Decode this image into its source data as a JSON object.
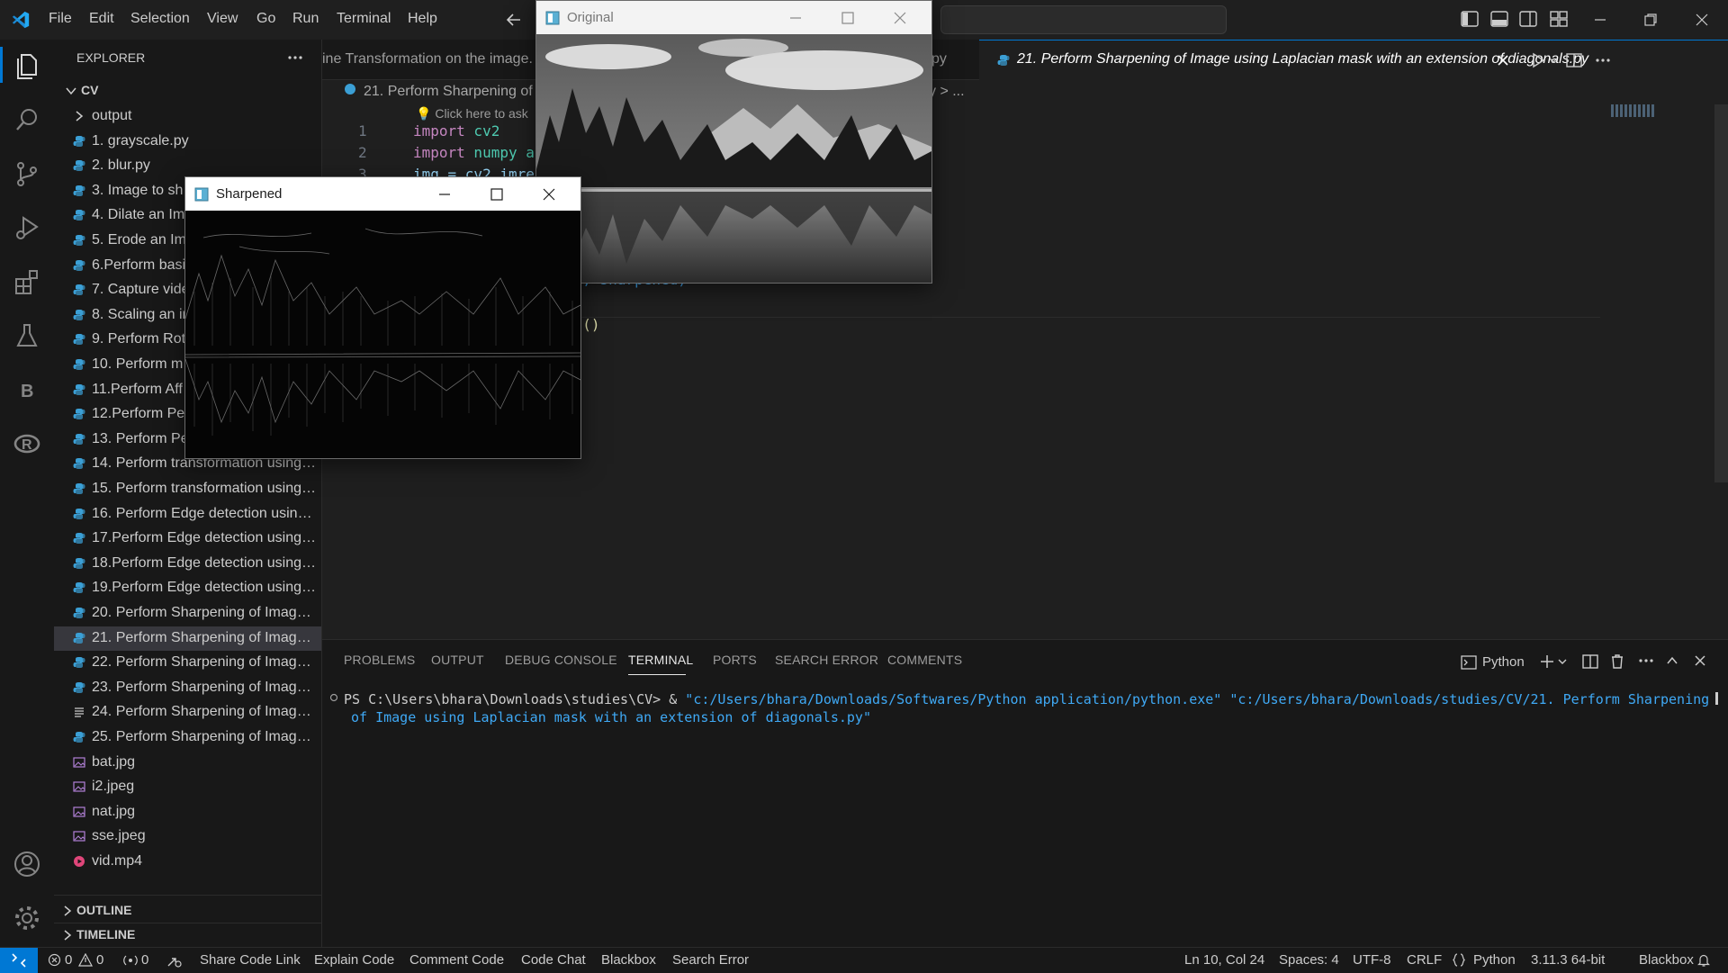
{
  "menu": [
    "File",
    "Edit",
    "Selection",
    "View",
    "Go",
    "Run",
    "Terminal",
    "Help"
  ],
  "explorer": {
    "title": "EXPLORER",
    "root": "CV",
    "items": [
      {
        "label": "output",
        "kind": "folder"
      },
      {
        "label": "1. grayscale.py",
        "kind": "py"
      },
      {
        "label": "2. blur.py",
        "kind": "py"
      },
      {
        "label": "3. Image to sh",
        "kind": "py"
      },
      {
        "label": "4. Dilate an Im",
        "kind": "py"
      },
      {
        "label": "5. Erode an Im",
        "kind": "py"
      },
      {
        "label": "6.Perform basi",
        "kind": "py"
      },
      {
        "label": "7. Capture vide",
        "kind": "py"
      },
      {
        "label": "8. Scaling an in",
        "kind": "py"
      },
      {
        "label": "9. Perform Rot",
        "kind": "py"
      },
      {
        "label": "10. Perform m",
        "kind": "py"
      },
      {
        "label": "11.Perform Aff",
        "kind": "py"
      },
      {
        "label": "12.Perform Pe",
        "kind": "py"
      },
      {
        "label": "13.  Perform Pe",
        "kind": "py"
      },
      {
        "label": "14. Perform transformation using ...",
        "kind": "py"
      },
      {
        "label": "15. Perform transformation using ...",
        "kind": "py"
      },
      {
        "label": "16. Perform Edge detection using...",
        "kind": "py"
      },
      {
        "label": "17.Perform Edge detection using ...",
        "kind": "py"
      },
      {
        "label": "18.Perform Edge detection using ...",
        "kind": "py"
      },
      {
        "label": "19.Perform Edge detection using ...",
        "kind": "py"
      },
      {
        "label": "20. Perform Sharpening of Image ...",
        "kind": "py"
      },
      {
        "label": "21. Perform Sharpening of Image ...",
        "kind": "py",
        "selected": true
      },
      {
        "label": "22. Perform Sharpening of Image ...",
        "kind": "py"
      },
      {
        "label": "23. Perform Sharpening of Image ...",
        "kind": "py"
      },
      {
        "label": "24. Perform Sharpening of Image ...",
        "kind": "txt"
      },
      {
        "label": "25. Perform Sharpening of Image ...",
        "kind": "py"
      },
      {
        "label": "bat.jpg",
        "kind": "img"
      },
      {
        "label": "i2.jpeg",
        "kind": "img"
      },
      {
        "label": "nat.jpg",
        "kind": "img"
      },
      {
        "label": "sse.jpeg",
        "kind": "img"
      },
      {
        "label": "vid.mp4",
        "kind": "video"
      }
    ],
    "outline": "OUTLINE",
    "timeline": "TIMELINE"
  },
  "editor": {
    "left_tab": "ine Transformation on the image.",
    "middle_tab_suffix": "py",
    "active_tab": "21. Perform Sharpening of Image using Laplacian mask with an extension of diagonals.py",
    "breadcrumb": "21. Perform Sharpening of",
    "breadcrumb_tail": "y > ...",
    "hint": "Click here to ask",
    "lines": [
      {
        "num": "1",
        "kw": "import",
        "rest": " cv2"
      },
      {
        "num": "2",
        "kw": "import",
        "rest": " numpy a"
      },
      {
        "num": "3",
        "kw": "",
        "rest": "img = cv2.imre"
      }
    ],
    "fragment_1": "d', sharpened)",
    "fragment_2": "ws()"
  },
  "panel": {
    "tabs": [
      "PROBLEMS",
      "OUTPUT",
      "DEBUG CONSOLE",
      "TERMINAL",
      "PORTS",
      "SEARCH ERROR",
      "COMMENTS"
    ],
    "active_tab": "TERMINAL",
    "shell": "Python",
    "prompt": "PS C:\\Users\\bhara\\Downloads\\studies\\CV> & ",
    "cmd_part1": "\"c:/Users/bhara/Downloads/Softwares/Python application/python.exe\" \"c:/Users/bhara/Downloads/studies/CV/21. Perform Sharpening",
    "cmd_part2": "of Image using Laplacian mask with an extension of diagonals.py\""
  },
  "windows": {
    "original_title": "Original",
    "sharpened_title": "Sharpened"
  },
  "status": {
    "errors": "0",
    "warnings": "0",
    "ports": "0",
    "left_items": [
      "Share Code Link",
      "Explain Code",
      "Comment Code",
      "Code Chat",
      "Blackbox",
      "Search Error"
    ],
    "position": "Ln 10, Col 24",
    "spaces": "Spaces: 4",
    "encoding": "UTF-8",
    "eol": "CRLF",
    "language": "Python",
    "interpreter": "3.11.3 64-bit",
    "blackbox": "Blackbox"
  },
  "colors": {
    "accent": "#0078d4",
    "keyword": "#c586c0",
    "module": "#4ec9b0",
    "string": "#3fa9f5",
    "py_icon": "#3b9fd5"
  }
}
